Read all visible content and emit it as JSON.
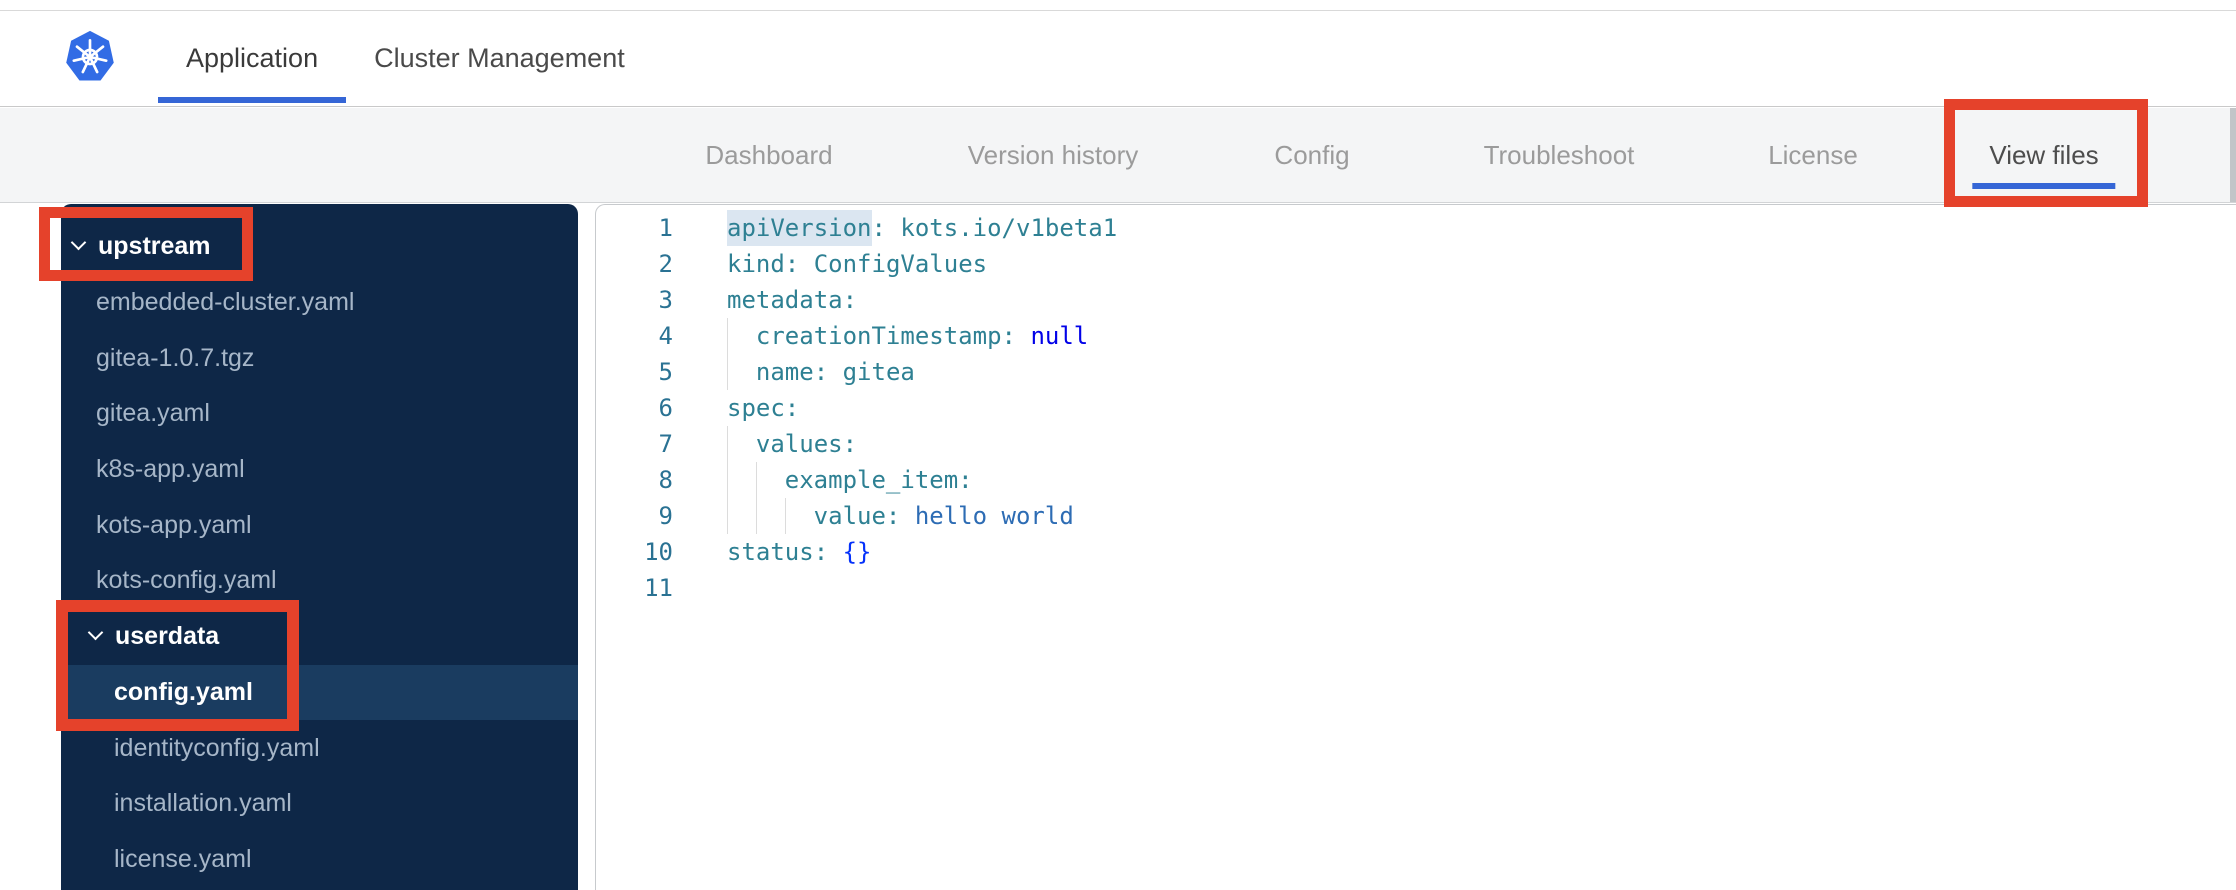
{
  "colors": {
    "accent_blue": "#3566d6",
    "kubernetes_blue": "#326ce5",
    "annotation_red": "#e5422b",
    "sidebar_bg": "#0e2747",
    "sidebar_selected_bg": "#1a3c60",
    "nav_bg": "#f4f5f6",
    "code_key": "#2e8093",
    "code_string": "#2d6cb4",
    "code_keyword": "#0202e8",
    "code_bracket": "#0431fa",
    "line_number": "#2a7293"
  },
  "header": {
    "logo_icon": "kubernetes-helm-wheel",
    "tabs": [
      {
        "label": "Application",
        "active": true
      },
      {
        "label": "Cluster Management",
        "active": false
      }
    ]
  },
  "nav": {
    "tabs": [
      {
        "label": "Dashboard",
        "active": false,
        "annotated": false
      },
      {
        "label": "Version history",
        "active": false,
        "annotated": false
      },
      {
        "label": "Config",
        "active": false,
        "annotated": false
      },
      {
        "label": "Troubleshoot",
        "active": false,
        "annotated": false
      },
      {
        "label": "License",
        "active": false,
        "annotated": false
      },
      {
        "label": "View files",
        "active": true,
        "annotated": true
      }
    ]
  },
  "file_tree": {
    "items": [
      {
        "type": "folder",
        "label": "upstream",
        "level": 0,
        "expanded": true,
        "selected": false,
        "annotated": true
      },
      {
        "type": "file",
        "label": "embedded-cluster.yaml",
        "level": 1,
        "selected": false
      },
      {
        "type": "file",
        "label": "gitea-1.0.7.tgz",
        "level": 1,
        "selected": false
      },
      {
        "type": "file",
        "label": "gitea.yaml",
        "level": 1,
        "selected": false
      },
      {
        "type": "file",
        "label": "k8s-app.yaml",
        "level": 1,
        "selected": false
      },
      {
        "type": "file",
        "label": "kots-app.yaml",
        "level": 1,
        "selected": false
      },
      {
        "type": "file",
        "label": "kots-config.yaml",
        "level": 1,
        "selected": false
      },
      {
        "type": "folder",
        "label": "userdata",
        "level": 1,
        "expanded": true,
        "selected": false,
        "annotated": true
      },
      {
        "type": "file",
        "label": "config.yaml",
        "level": 2,
        "selected": true,
        "annotated": true
      },
      {
        "type": "file",
        "label": "identityconfig.yaml",
        "level": 2,
        "selected": false
      },
      {
        "type": "file",
        "label": "installation.yaml",
        "level": 2,
        "selected": false
      },
      {
        "type": "file",
        "label": "license.yaml",
        "level": 2,
        "selected": false
      }
    ]
  },
  "editor": {
    "language": "yaml",
    "lines": [
      {
        "num": 1,
        "indent": 0,
        "tokens": [
          {
            "t": "apiVersion",
            "c": "k",
            "hl": true
          },
          {
            "t": ": ",
            "c": "p"
          },
          {
            "t": "kots.io/v1beta1",
            "c": "v"
          }
        ]
      },
      {
        "num": 2,
        "indent": 0,
        "tokens": [
          {
            "t": "kind",
            "c": "k"
          },
          {
            "t": ": ",
            "c": "p"
          },
          {
            "t": "ConfigValues",
            "c": "v"
          }
        ]
      },
      {
        "num": 3,
        "indent": 0,
        "tokens": [
          {
            "t": "metadata",
            "c": "k"
          },
          {
            "t": ":",
            "c": "p"
          }
        ]
      },
      {
        "num": 4,
        "indent": 2,
        "tokens": [
          {
            "t": "creationTimestamp",
            "c": "k"
          },
          {
            "t": ": ",
            "c": "p"
          },
          {
            "t": "null",
            "c": "kw"
          }
        ]
      },
      {
        "num": 5,
        "indent": 2,
        "tokens": [
          {
            "t": "name",
            "c": "k"
          },
          {
            "t": ": ",
            "c": "p"
          },
          {
            "t": "gitea",
            "c": "v"
          }
        ]
      },
      {
        "num": 6,
        "indent": 0,
        "tokens": [
          {
            "t": "spec",
            "c": "k"
          },
          {
            "t": ":",
            "c": "p"
          }
        ]
      },
      {
        "num": 7,
        "indent": 2,
        "tokens": [
          {
            "t": "values",
            "c": "k"
          },
          {
            "t": ":",
            "c": "p"
          }
        ]
      },
      {
        "num": 8,
        "indent": 4,
        "tokens": [
          {
            "t": "example_item",
            "c": "k"
          },
          {
            "t": ":",
            "c": "p"
          }
        ]
      },
      {
        "num": 9,
        "indent": 6,
        "tokens": [
          {
            "t": "value",
            "c": "k"
          },
          {
            "t": ": ",
            "c": "p"
          },
          {
            "t": "hello world",
            "c": "s"
          }
        ]
      },
      {
        "num": 10,
        "indent": 0,
        "tokens": [
          {
            "t": "status",
            "c": "k"
          },
          {
            "t": ": ",
            "c": "p"
          },
          {
            "t": "{}",
            "c": "b"
          }
        ]
      },
      {
        "num": 11,
        "indent": 0,
        "tokens": []
      }
    ]
  },
  "annotations": [
    {
      "target": "view-files-tab"
    },
    {
      "target": "upstream-folder"
    },
    {
      "target": "userdata-and-config-yaml"
    }
  ]
}
